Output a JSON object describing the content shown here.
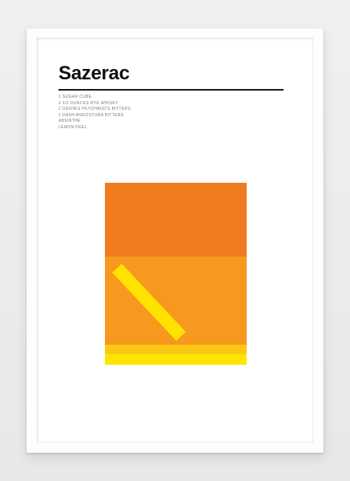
{
  "poster": {
    "title": "Sazerac",
    "ingredients": [
      "1 Sugar Cube",
      "2 1/2 Ounces Rye Whisky",
      "2 Dashes Peychaud's Bitters",
      "1 Dash Angostura Bitters",
      "Absinthe",
      "Lemon Peel"
    ]
  },
  "colors": {
    "wall": "#ececec",
    "frame": "#fdfdfd",
    "mat": "#ffffff",
    "title_text": "#111111",
    "rule": "#1a1a1a",
    "ingredient_text": "#7a7a7a",
    "top_layer": "#f07c22",
    "bottom_layer": "#f7981f",
    "peel": "#ffe200",
    "base_stripe": "#fbc813",
    "base": "#ffe600"
  },
  "illustration": {
    "layers": [
      {
        "name": "top-layer",
        "share": 0.405
      },
      {
        "name": "bottom-layer",
        "share": 0.595
      }
    ]
  }
}
